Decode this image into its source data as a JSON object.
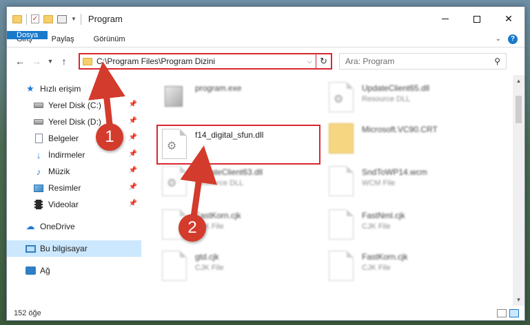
{
  "window": {
    "title": "Program"
  },
  "ribbon": {
    "tabs": [
      "Dosya",
      "Giriş",
      "Paylaş",
      "Görünüm"
    ]
  },
  "address": {
    "path": "C:\\Program Files\\Program Dizini"
  },
  "search": {
    "placeholder": "Ara: Program"
  },
  "nav_pane": {
    "quick_access": "Hızlı erişim",
    "items": [
      "Yerel Disk (C:)",
      "Yerel Disk (D:)",
      "Belgeler",
      "İndirmeler",
      "Müzik",
      "Resimler",
      "Videolar"
    ],
    "onedrive": "OneDrive",
    "this_pc": "Bu bilgisayar",
    "network": "Ağ"
  },
  "files": [
    {
      "name": "program.exe",
      "type": ""
    },
    {
      "name": "UpdateClient65.dll",
      "type": "Resource DLL"
    },
    {
      "name": "f14_digital_sfun.dll",
      "type": ""
    },
    {
      "name": "Microsoft.VC90.CRT",
      "type": ""
    },
    {
      "name": "UpdateClient63.dll",
      "type": "Resource DLL"
    },
    {
      "name": "SndToWP14.wcm",
      "type": "WCM File"
    },
    {
      "name": "FastKorn.cjk",
      "type": "CJK File"
    },
    {
      "name": "FastNml.cjk",
      "type": "CJK File"
    },
    {
      "name": "gtd.cjk",
      "type": "CJK File"
    },
    {
      "name": "FastKorn.cjk",
      "type": "CJK File"
    }
  ],
  "status": {
    "count": "152 öğe"
  },
  "annotations": {
    "badge1": "1",
    "badge2": "2"
  },
  "colors": {
    "accent": "#1979ca",
    "highlight": "#d9262f",
    "badge": "#d33b2c"
  }
}
